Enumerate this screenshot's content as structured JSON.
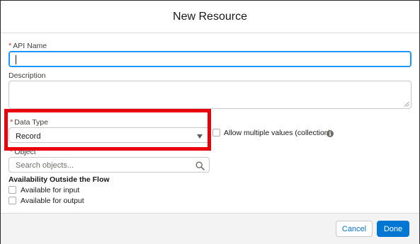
{
  "modal": {
    "title": "New Resource"
  },
  "form": {
    "api_name": {
      "required_mark": "*",
      "label": "API Name",
      "value": ""
    },
    "description": {
      "label": "Description",
      "value": ""
    },
    "data_type": {
      "required_mark": "*",
      "label": "Data Type",
      "selected": "Record"
    },
    "allow_multiple": {
      "label": "Allow multiple values (collection)",
      "checked": false,
      "info_glyph": "i"
    },
    "object": {
      "required_mark": "*",
      "label": "Object",
      "placeholder": "Search objects..."
    },
    "availability": {
      "heading": "Availability Outside the Flow",
      "options": [
        {
          "label": "Available for input",
          "checked": false
        },
        {
          "label": "Available for output",
          "checked": false
        }
      ]
    }
  },
  "footer": {
    "cancel_label": "Cancel",
    "done_label": "Done"
  },
  "colors": {
    "highlight": "#e8000b",
    "brand": "#0176d3",
    "focus": "#1b96ff"
  },
  "icons": {
    "dropdown": "chevron-down-icon",
    "search": "search-icon",
    "info": "info-icon"
  }
}
